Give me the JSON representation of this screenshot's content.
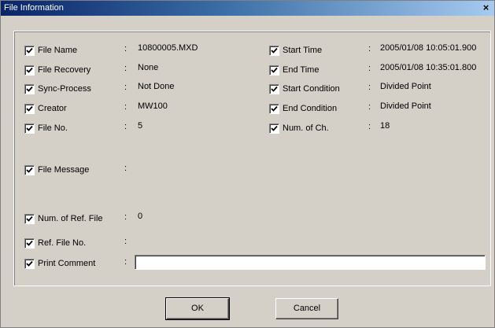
{
  "window": {
    "title": "File Information",
    "close_glyph": "×"
  },
  "left_fields": [
    {
      "label": "File Name",
      "value": "10800005.MXD",
      "checked": true
    },
    {
      "label": "File Recovery",
      "value": "None",
      "checked": true
    },
    {
      "label": "Sync-Process",
      "value": "Not Done",
      "checked": true
    },
    {
      "label": "Creator",
      "value": "MW100",
      "checked": true
    },
    {
      "label": "File No.",
      "value": "5",
      "checked": true
    },
    {
      "label": "File Message",
      "value": "",
      "checked": true
    },
    {
      "label": "Num. of Ref. File",
      "value": "0",
      "checked": true
    },
    {
      "label": "Ref. File No.",
      "value": "",
      "checked": true
    },
    {
      "label": "Print Comment",
      "value": "",
      "checked": true
    }
  ],
  "right_fields": [
    {
      "label": "Start Time",
      "value": "2005/01/08 10:05:01.900",
      "checked": true
    },
    {
      "label": "End Time",
      "value": "2005/01/08 10:35:01.800",
      "checked": true
    },
    {
      "label": "Start Condition",
      "value": "Divided Point",
      "checked": true
    },
    {
      "label": "End Condition",
      "value": "Divided Point",
      "checked": true
    },
    {
      "label": "Num. of Ch.",
      "value": "18",
      "checked": true
    }
  ],
  "separator": ":",
  "buttons": {
    "ok": "OK",
    "cancel": "Cancel"
  }
}
